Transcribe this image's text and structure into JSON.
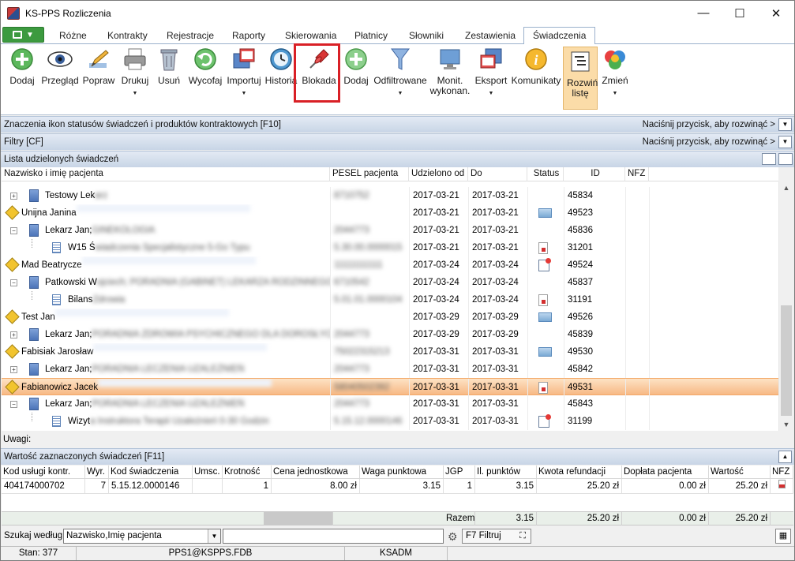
{
  "window": {
    "title": "KS-PPS Rozliczenia",
    "minimize": "—",
    "maximize": "☐",
    "close": "✕"
  },
  "menu_tabs": [
    "Różne",
    "Kontrakty",
    "Rejestracje",
    "Raporty",
    "Skierowania",
    "Płatnicy",
    "Słowniki",
    "Zestawienia",
    "Świadczenia"
  ],
  "active_tab": "Świadczenia",
  "ribbon": {
    "buttons": [
      {
        "label": "Dodaj",
        "icon": "add-green-icon",
        "dropdown": false
      },
      {
        "label": "Przegląd",
        "icon": "eye-icon",
        "dropdown": false
      },
      {
        "label": "Popraw",
        "icon": "pencil-edit-icon",
        "dropdown": false
      },
      {
        "label": "Drukuj",
        "icon": "printer-icon",
        "dropdown": true
      },
      {
        "label": "Usuń",
        "icon": "trash-can-icon",
        "dropdown": false
      },
      {
        "label": "Wycofaj",
        "icon": "undo-green-icon",
        "dropdown": false
      },
      {
        "label": "Importuj",
        "icon": "import-window-icon",
        "dropdown": true
      },
      {
        "label": "Historia",
        "icon": "clock-history-icon",
        "dropdown": false
      },
      {
        "label": "Blokada",
        "icon": "red-pushpin-icon",
        "dropdown": false
      },
      {
        "label": "Dodaj",
        "icon": "add-green-icon",
        "dropdown": false
      },
      {
        "label": "Odfiltrowane",
        "icon": "funnel-icon",
        "dropdown": true
      },
      {
        "label": "Monit. wykonan.",
        "icon": "monitor-icon",
        "dropdown": false
      },
      {
        "label": "Eksport",
        "icon": "export-window-icon",
        "dropdown": true
      },
      {
        "label": "Komunikaty",
        "icon": "info-icon",
        "dropdown": false
      },
      {
        "label": "Rozwiń listę",
        "icon": "expand-list-icon",
        "dropdown": false,
        "pressed": true
      },
      {
        "label": "Zmień",
        "icon": "color-balls-icon",
        "dropdown": true
      }
    ]
  },
  "bands": {
    "legend": {
      "label": "Znaczenia ikon statusów świadczeń i produktów kontraktowych [F10]",
      "hint": "Naciśnij przycisk, aby rozwinąć >"
    },
    "filters": {
      "label": "Filtry [CF]",
      "hint": "Naciśnij przycisk, aby rozwinąć >"
    },
    "list": {
      "label": "Lista udzielonych świadczeń"
    }
  },
  "grid": {
    "columns": [
      "Nazwisko i imię pacjenta",
      "PESEL pacjenta",
      "Udzielono od",
      "Do",
      "Status",
      "ID",
      "NFZ"
    ],
    "rows": [
      {
        "level": 1,
        "icon": "doctor",
        "name": "Testowy Lek",
        "desc": "arz",
        "pesel": "8710752",
        "od": "2017-03-21",
        "do": "2017-03-21",
        "status": "none",
        "id": "45834"
      },
      {
        "level": 0,
        "icon": "patient",
        "name": "Unijna Janina",
        "desc": "",
        "pesel": "",
        "od": "2017-03-21",
        "do": "2017-03-21",
        "status": "mail",
        "id": "49523"
      },
      {
        "level": 1,
        "icon": "doctor",
        "name": "Lekarz Jan;",
        "desc": "GINEKOLOGIA",
        "pesel": "2044773",
        "od": "2017-03-21",
        "do": "2017-03-21",
        "status": "none",
        "id": "45836"
      },
      {
        "level": 2,
        "icon": "proc",
        "name": "W15 Ś",
        "desc": "wiadczenia Specjalistyczne 5-Go Typu",
        "pesel": "5.30.00.0000015",
        "od": "2017-03-21",
        "do": "2017-03-21",
        "status": "doc",
        "id": "31201"
      },
      {
        "level": 0,
        "icon": "patient",
        "name": "Mad Beatrycze",
        "desc": "",
        "pesel": "11111111111",
        "od": "2017-03-24",
        "do": "2017-03-24",
        "status": "cal",
        "id": "49524"
      },
      {
        "level": 1,
        "icon": "doctor",
        "name": "Patkowski W",
        "desc": "ojciech; PORADNIA (GABINET) LEKARZA RODZINNEGO",
        "pesel": "6710542",
        "od": "2017-03-24",
        "do": "2017-03-24",
        "status": "none",
        "id": "45837"
      },
      {
        "level": 2,
        "icon": "proc",
        "name": "Bilans",
        "desc": "Zdrowia",
        "pesel": "5.01.01.0000104",
        "od": "2017-03-24",
        "do": "2017-03-24",
        "status": "doc",
        "id": "31191"
      },
      {
        "level": 0,
        "icon": "patient",
        "name": "Test Jan",
        "desc": "",
        "pesel": "",
        "od": "2017-03-29",
        "do": "2017-03-29",
        "status": "mail",
        "id": "49526"
      },
      {
        "level": 1,
        "icon": "doctor",
        "name": "Lekarz Jan;",
        "desc": "PORADNIA ZDROWIA PSYCHICZNEGO DLA DOROSŁYCH",
        "pesel": "2044773",
        "od": "2017-03-29",
        "do": "2017-03-29",
        "status": "none",
        "id": "45839"
      },
      {
        "level": 0,
        "icon": "patient",
        "name": "Fabisiak Jarosław",
        "desc": "",
        "pesel": "75022315213",
        "od": "2017-03-31",
        "do": "2017-03-31",
        "status": "mail",
        "id": "49530"
      },
      {
        "level": 1,
        "icon": "doctor",
        "name": "Lekarz Jan;",
        "desc": "PORADNIA LECZENIA UZALEŻNIEŃ",
        "pesel": "2044773",
        "od": "2017-03-31",
        "do": "2017-03-31",
        "status": "none",
        "id": "45842"
      },
      {
        "level": 0,
        "icon": "patient",
        "name": "Fabianowicz Jacek",
        "desc": "",
        "pesel": "58040502392",
        "od": "2017-03-31",
        "do": "2017-03-31",
        "status": "doc",
        "id": "49531",
        "selected": true
      },
      {
        "level": 1,
        "icon": "doctor",
        "name": "Lekarz Jan;",
        "desc": "PORADNIA LECZENIA UZALEŻNIEŃ",
        "pesel": "2044773",
        "od": "2017-03-31",
        "do": "2017-03-31",
        "status": "none",
        "id": "45843"
      },
      {
        "level": 2,
        "icon": "proc",
        "name": "Wizyt",
        "desc": "a Instruktora Terapii Uzależnień 0-30 Godzin",
        "pesel": "5.15.12.0000146",
        "od": "2017-03-31",
        "do": "2017-03-31",
        "status": "cal",
        "id": "31199"
      }
    ]
  },
  "uwagi": {
    "label": "Uwagi:"
  },
  "values_panel": {
    "label": "Wartość zaznaczonych świadczeń [F11]",
    "columns": [
      "Kod usługi kontr.",
      "Wyr.",
      "Kod świadczenia",
      "Umsc.",
      "Krotność",
      "Cena jednostkowa",
      "Waga punktowa",
      "JGP",
      "Il. punktów",
      "Kwota refundacji",
      "Dopłata pacjenta",
      "Wartość",
      "NFZ"
    ],
    "row": [
      "404174000702",
      "7",
      "5.15.12.0000146",
      "",
      "1",
      "8.00 zł",
      "3.15",
      "1",
      "3.15",
      "25.20 zł",
      "0.00 zł",
      "25.20 zł",
      ""
    ],
    "totals": {
      "label": "Razem",
      "points": "3.15",
      "refund": "25.20 zł",
      "copay": "0.00 zł",
      "value": "25.20 zł"
    }
  },
  "search": {
    "label": "Szukaj według:",
    "field": "Nazwisko,Imię pacjenta",
    "value": "",
    "filter_btn": "F7 Filtruj"
  },
  "status": {
    "stan": "Stan: 377",
    "db": "PPS1@KSPPS.FDB",
    "user": "KSADM"
  },
  "colors": {
    "accent": "#3c9a3f",
    "selection": "#f7b985",
    "highlight_box": "#d92026",
    "band": "#c8d5e6"
  }
}
